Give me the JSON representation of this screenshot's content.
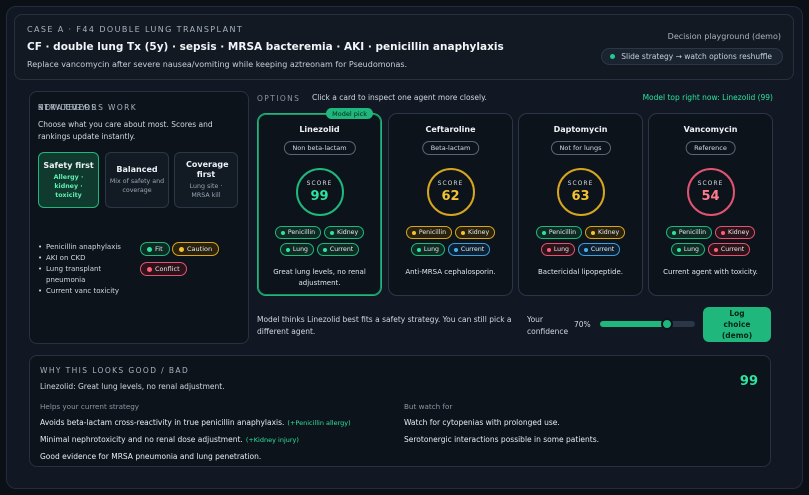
{
  "header": {
    "case_label": "CASE A · F44 DOUBLE LUNG TRANSPLANT",
    "title": "CF · double lung Tx (5y) · sepsis · MRSA bacteremia · AKI · penicillin anaphylaxis",
    "subtitle": "Replace vancomycin after severe nausea/vomiting while keeping aztreonam for Pseudomonas.",
    "playground_label": "Decision playground (demo)",
    "strategy_pill": "Slide strategy → watch options reshuffle"
  },
  "strategy": {
    "section_label": "STRATEGY",
    "description": "Choose what you care about most. Scores and rankings update instantly.",
    "buttons": [
      {
        "title": "Safety first",
        "subtitle": "Allergy · kidney · toxicity",
        "active": true
      },
      {
        "title": "Balanced",
        "subtitle": "Mix of safety and coverage",
        "active": false
      },
      {
        "title": "Coverage first",
        "subtitle": "Lung site · MRSA kill",
        "active": false
      }
    ],
    "key_levers_label": "KEY LEVERS",
    "key_levers": [
      "Penicillin anaphylaxis",
      "AKI on CKD",
      "Lung transplant pneumonia",
      "Current vanc toxicity"
    ],
    "colors_label": "HOW COLORS WORK",
    "legend": {
      "fit": "Fit",
      "caution": "Caution",
      "conflict": "Conflict"
    }
  },
  "options": {
    "section_label": "OPTIONS",
    "instruction": "Click a card to inspect one agent more closely.",
    "model_top": "Model top right now: Linezolid (99)",
    "model_pick_badge": "Model pick",
    "score_label": "SCORE",
    "cards": [
      {
        "name": "Linezolid",
        "class": "Non beta-lactam",
        "score": "99",
        "score_color": "#2ee39f",
        "ring_color": "#1fb77c",
        "chips": [
          {
            "label": "Penicillin",
            "kind": "fit"
          },
          {
            "label": "Kidney",
            "kind": "fit"
          },
          {
            "label": "Lung",
            "kind": "fit"
          },
          {
            "label": "Current",
            "kind": "fit"
          }
        ],
        "desc": "Great lung levels, no renal adjustment."
      },
      {
        "name": "Ceftaroline",
        "class": "Beta-lactam",
        "score": "62",
        "score_color": "#f2c233",
        "ring_color": "#d6a51f",
        "chips": [
          {
            "label": "Penicillin",
            "kind": "caution"
          },
          {
            "label": "Kidney",
            "kind": "caution"
          },
          {
            "label": "Lung",
            "kind": "fit"
          },
          {
            "label": "Current",
            "kind": "current"
          }
        ],
        "desc": "Anti-MRSA cephalosporin."
      },
      {
        "name": "Daptomycin",
        "class": "Not for lungs",
        "score": "63",
        "score_color": "#f2c233",
        "ring_color": "#d6a51f",
        "chips": [
          {
            "label": "Penicillin",
            "kind": "fit"
          },
          {
            "label": "Kidney",
            "kind": "caution"
          },
          {
            "label": "Lung",
            "kind": "conflict"
          },
          {
            "label": "Current",
            "kind": "current"
          }
        ],
        "desc": "Bactericidal lipopeptide."
      },
      {
        "name": "Vancomycin",
        "class": "Reference",
        "score": "54",
        "score_color": "#ff7a8e",
        "ring_color": "#e0546f",
        "chips": [
          {
            "label": "Penicillin",
            "kind": "fit"
          },
          {
            "label": "Kidney",
            "kind": "conflict"
          },
          {
            "label": "Lung",
            "kind": "fit"
          },
          {
            "label": "Current",
            "kind": "conflict"
          }
        ],
        "desc": "Current agent with toxicity."
      }
    ],
    "model_thinks": "Model thinks Linezolid best fits a safety strategy. You can still pick a different agent.",
    "confidence_label": "Your confidence",
    "confidence_value": "70%",
    "confidence_fraction": 0.7,
    "log_button": "Log choice (demo)"
  },
  "why": {
    "section_label": "WHY THIS LOOKS GOOD / BAD",
    "summary": "Linezolid: Great lung levels, no renal adjustment.",
    "score": "99",
    "helps_label": "Helps your current strategy",
    "helps": [
      {
        "text": "Avoids beta-lactam cross-reactivity in true penicillin anaphylaxis.",
        "tag": "(+Penicillin allergy)"
      },
      {
        "text": "Minimal nephrotoxicity and no renal dose adjustment.",
        "tag": "(+Kidney injury)"
      },
      {
        "text": "Good evidence for MRSA pneumonia and lung penetration.",
        "tag": ""
      }
    ],
    "watch_label": "But watch for",
    "watch": [
      "Watch for cytopenias with prolonged use.",
      "Serotonergic interactions possible in some patients."
    ]
  }
}
